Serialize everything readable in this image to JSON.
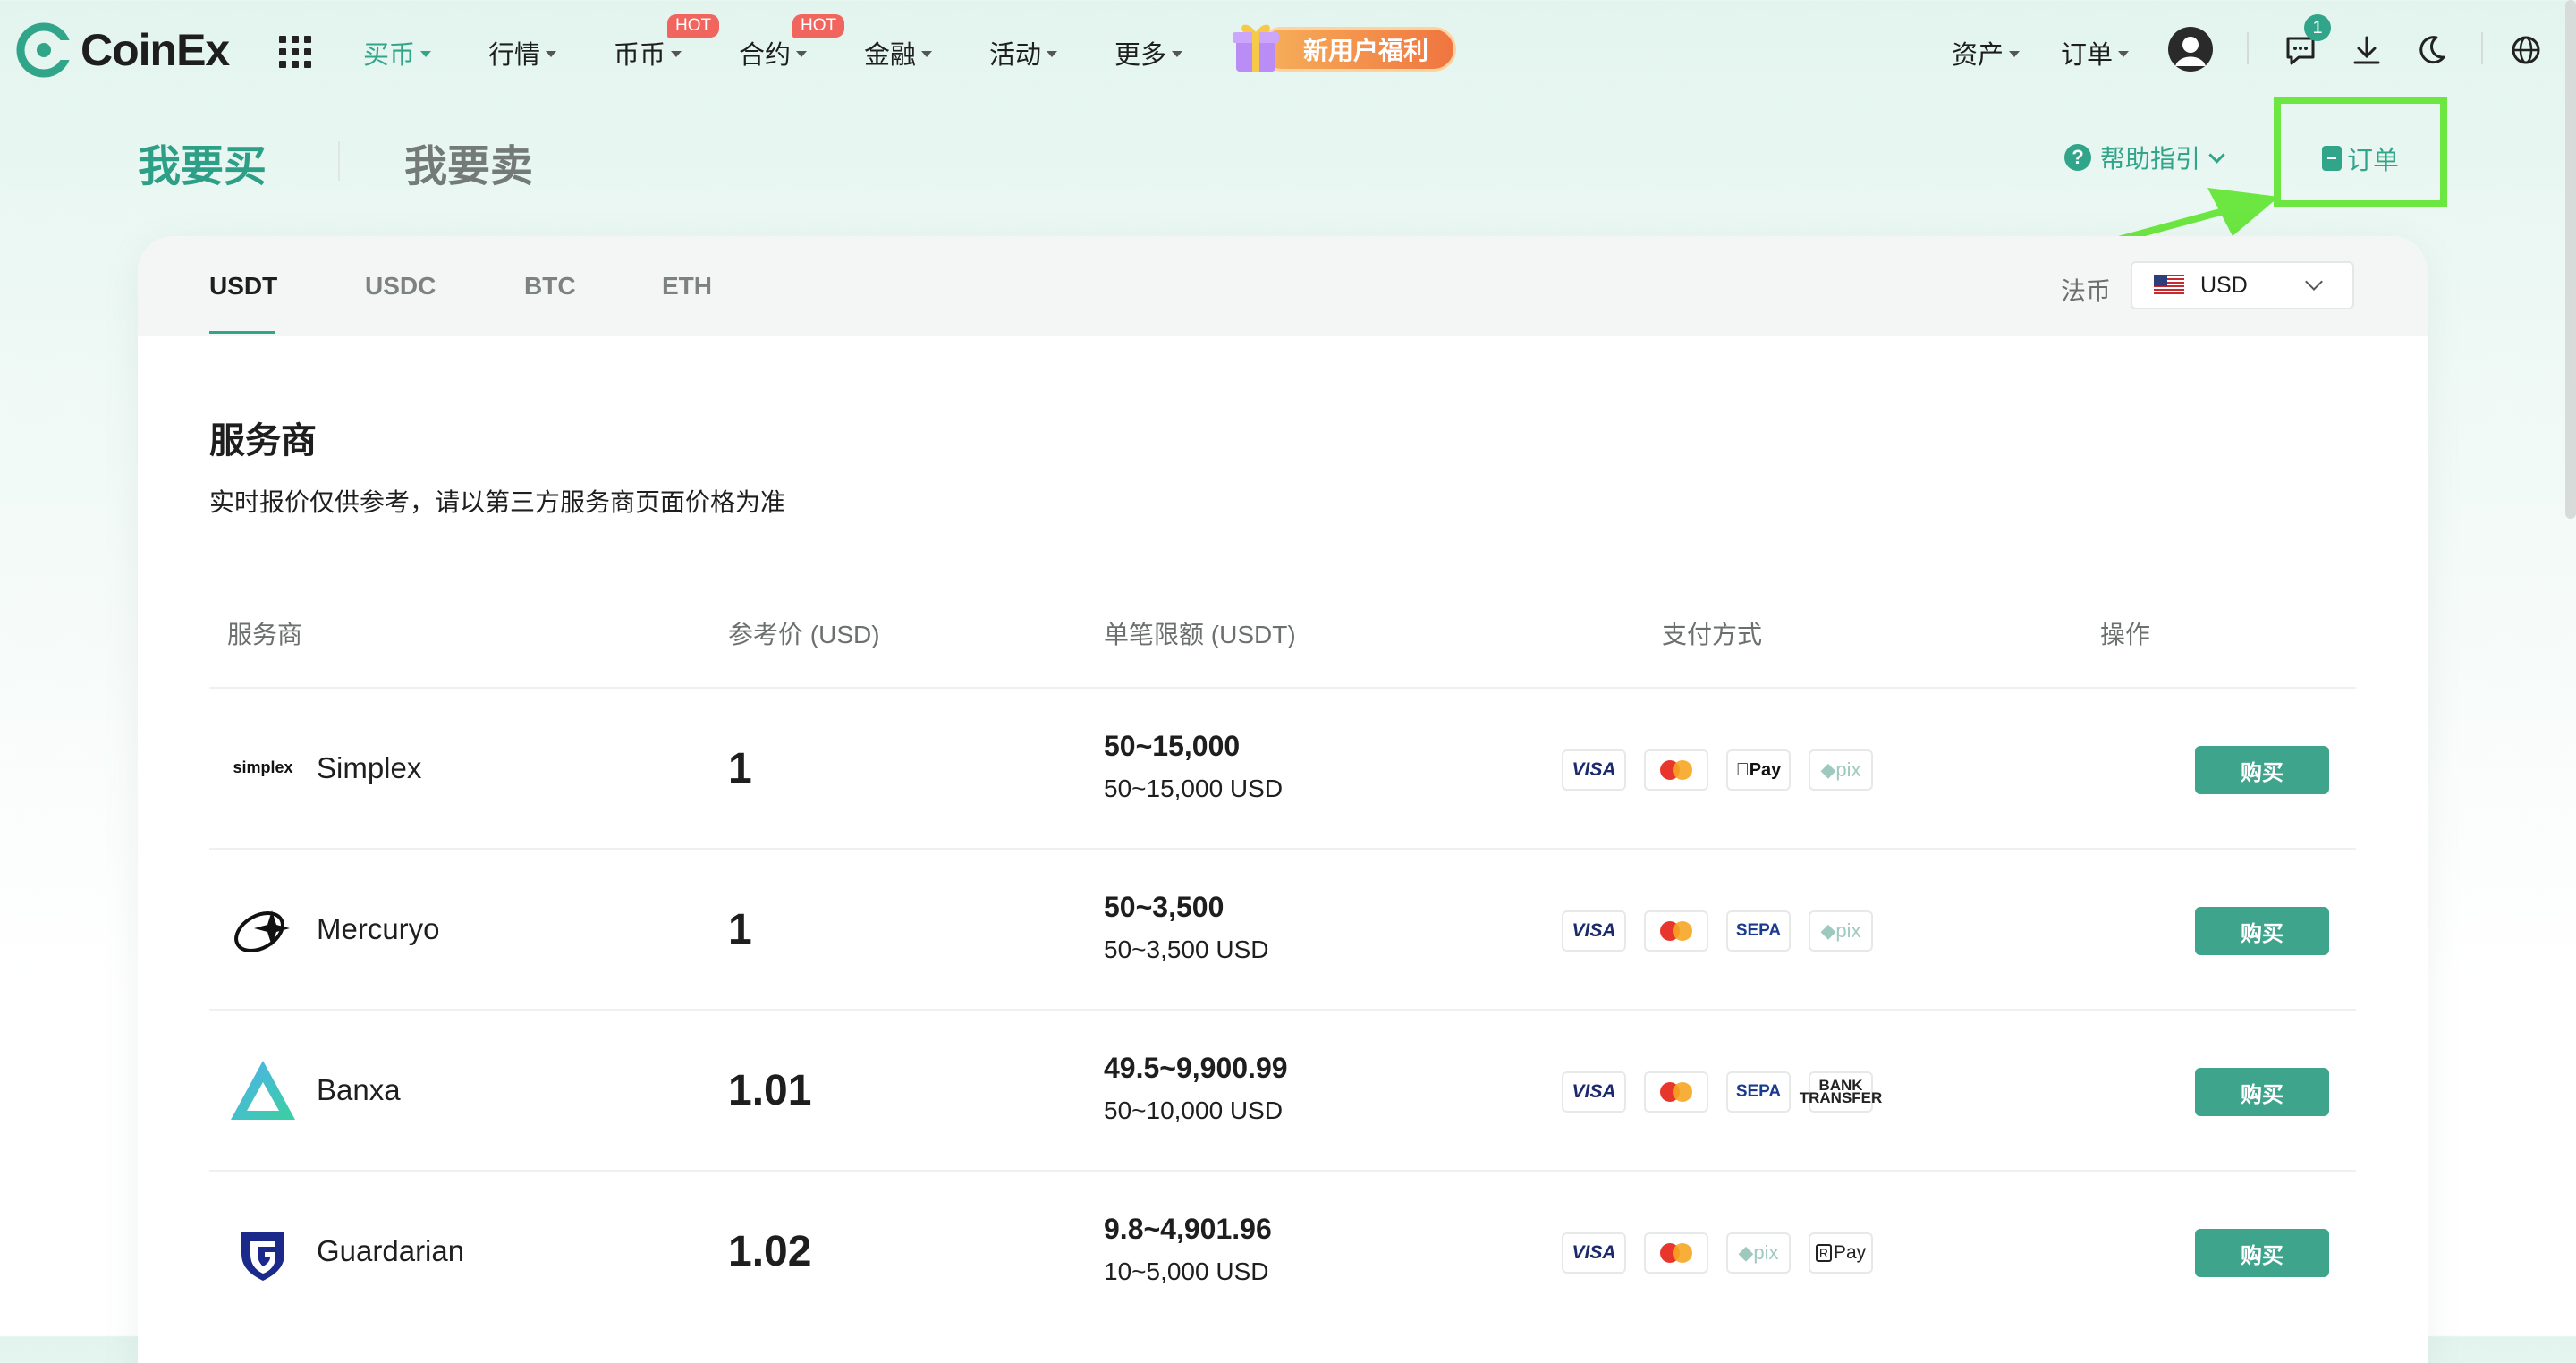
{
  "nav": {
    "logo_text": "CoinEx",
    "items": [
      {
        "label": "买币",
        "active": true,
        "hot": false
      },
      {
        "label": "行情",
        "active": false,
        "hot": false
      },
      {
        "label": "币币",
        "active": false,
        "hot": true
      },
      {
        "label": "合约",
        "active": false,
        "hot": true
      },
      {
        "label": "金融",
        "active": false,
        "hot": false
      },
      {
        "label": "活动",
        "active": false,
        "hot": false
      },
      {
        "label": "更多",
        "active": false,
        "hot": false
      }
    ],
    "hot_badge": "HOT",
    "promo_label": "新用户福利",
    "assets_label": "资产",
    "orders_label": "订单",
    "notification_count": "1"
  },
  "page": {
    "buy_tab": "我要买",
    "sell_tab": "我要卖",
    "help_label": "帮助指引",
    "orders_button": "订单"
  },
  "coin_tabs": [
    "USDT",
    "USDC",
    "BTC",
    "ETH"
  ],
  "fiat": {
    "label": "法币",
    "value": "USD"
  },
  "section": {
    "title": "服务商",
    "note": "实时报价仅供参考，请以第三方服务商页面价格为准"
  },
  "table": {
    "headers": [
      "服务商",
      "参考价 (USD)",
      "单笔限额 (USDT)",
      "支付方式",
      "操作"
    ],
    "buy_label": "购买",
    "rows": [
      {
        "provider": "Simplex",
        "logo_text": "simplex",
        "price": "1",
        "limit": "50~15,000",
        "limit_fiat": "50~15,000 USD",
        "payments": [
          "VISA",
          "mastercard",
          "Pay",
          "pix"
        ]
      },
      {
        "provider": "Mercuryo",
        "price": "1",
        "limit": "50~3,500",
        "limit_fiat": "50~3,500 USD",
        "payments": [
          "VISA",
          "mastercard",
          "SEPA",
          "pix"
        ]
      },
      {
        "provider": "Banxa",
        "price": "1.01",
        "limit": "49.5~9,900.99",
        "limit_fiat": "50~10,000 USD",
        "payments": [
          "VISA",
          "mastercard",
          "SEPA",
          "BANK TRANSFER"
        ]
      },
      {
        "provider": "Guardarian",
        "price": "1.02",
        "limit": "9.8~4,901.96",
        "limit_fiat": "10~5,000 USD",
        "payments": [
          "VISA",
          "mastercard",
          "pix",
          "Pay"
        ]
      }
    ]
  },
  "colors": {
    "accent": "#31a58a",
    "highlight": "#6ce640",
    "hot": "#f0655d"
  }
}
